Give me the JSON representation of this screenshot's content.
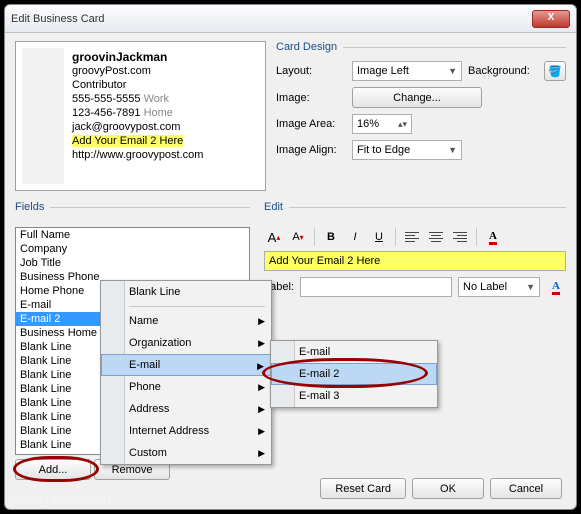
{
  "window": {
    "title": "Edit Business Card"
  },
  "preview": {
    "name": "groovinJackman",
    "company": "groovyPost.com",
    "jobtitle": "Contributor",
    "phone1": "555-555-5555",
    "phone1_label": "Work",
    "phone2": "123-456-7891",
    "phone2_label": "Home",
    "email1": "jack@groovypost.com",
    "email2": "Add Your Email 2 Here",
    "url": "http://www.groovypost.com"
  },
  "design": {
    "legend": "Card Design",
    "layout_label": "Layout:",
    "layout_value": "Image Left",
    "background_label": "Background:",
    "image_label": "Image:",
    "change_btn": "Change...",
    "area_label": "Image Area:",
    "area_value": "16%",
    "align_label": "Image Align:",
    "align_value": "Fit to Edge"
  },
  "fields": {
    "legend": "Fields",
    "items": [
      "Full Name",
      "Company",
      "Job Title",
      "Business Phone",
      "Home Phone",
      "E-mail",
      "E-mail 2",
      "Business Home",
      "Blank Line",
      "Blank Line",
      "Blank Line",
      "Blank Line",
      "Blank Line",
      "Blank Line",
      "Blank Line",
      "Blank Line"
    ],
    "selected_index": 6,
    "add_btn": "Add...",
    "remove_btn": "Remove"
  },
  "edit": {
    "legend": "Edit",
    "value": "Add Your Email 2 Here",
    "label_label": "Label:",
    "label_value": "",
    "nolabel": "No Label"
  },
  "context_menu": {
    "items": [
      "Blank Line",
      "Name",
      "Organization",
      "E-mail",
      "Phone",
      "Address",
      "Internet Address",
      "Custom"
    ],
    "hover": 3
  },
  "submenu": {
    "items": [
      "E-mail",
      "E-mail 2",
      "E-mail 3"
    ],
    "hover": 1
  },
  "buttons": {
    "reset": "Reset Card",
    "ok": "OK",
    "cancel": "Cancel"
  },
  "watermark": "groovyPost.com"
}
